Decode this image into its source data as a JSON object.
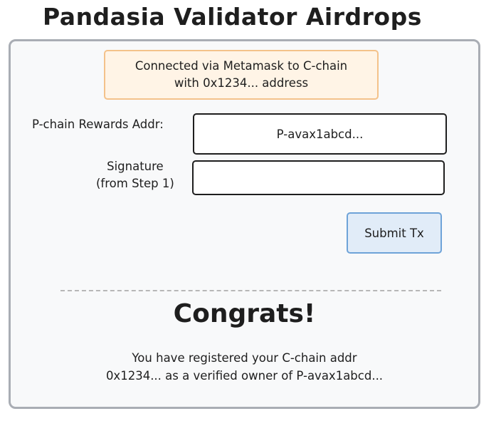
{
  "title": "Pandasia Validator Airdrops",
  "connection": {
    "line1": "Connected via Metamask to C-chain",
    "line2": "with 0x1234... address"
  },
  "form": {
    "rewards_label": "P-chain Rewards Addr:",
    "rewards_value": "P-avax1abcd...",
    "signature_label_line1": "Signature",
    "signature_label_line2": "(from Step 1)",
    "signature_value": "",
    "submit_label": "Submit Tx"
  },
  "result": {
    "heading": "Congrats!",
    "line1": "You have registered your C-chain addr",
    "line2": "0x1234... as a verified owner of P-avax1abcd..."
  },
  "colors": {
    "connected_bg": "#fff4e6",
    "connected_border": "#f4c28a",
    "button_bg": "#e1ecf8",
    "button_border": "#6ea3d8",
    "frame_border": "#a9adb4"
  }
}
